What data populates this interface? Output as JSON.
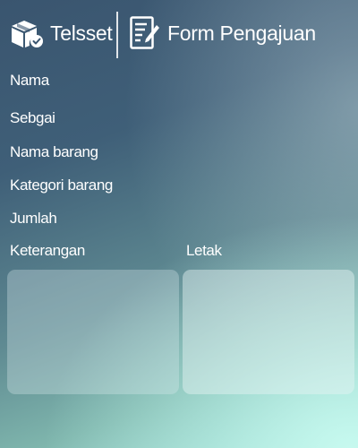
{
  "header": {
    "brand": "Telsset",
    "title": "Form Pengajuan",
    "logo_icon": "package-check-icon",
    "form_icon": "form-edit-icon"
  },
  "form": {
    "nama_label": "Nama",
    "sebagai_label": "Sebgai",
    "nama_barang_label": "Nama barang",
    "kategori_label": "Kategori barang",
    "jumlah_label": "Jumlah",
    "keterangan_label": "Keterangan",
    "letak_label": "Letak",
    "keterangan_value": "",
    "letak_value": ""
  }
}
